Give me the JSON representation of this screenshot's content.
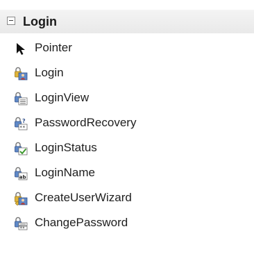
{
  "toolbox": {
    "group": {
      "title": "Login",
      "expanded": true,
      "icon": "collapse-minus-icon"
    },
    "items": [
      {
        "label": "Pointer",
        "icon": "pointer-arrow-icon"
      },
      {
        "label": "Login",
        "icon": "login-control-icon"
      },
      {
        "label": "LoginView",
        "icon": "loginview-control-icon"
      },
      {
        "label": "PasswordRecovery",
        "icon": "password-recovery-icon"
      },
      {
        "label": "LoginStatus",
        "icon": "login-status-icon"
      },
      {
        "label": "LoginName",
        "icon": "login-name-icon"
      },
      {
        "label": "CreateUserWizard",
        "icon": "create-user-wizard-icon"
      },
      {
        "label": "ChangePassword",
        "icon": "change-password-icon"
      }
    ]
  },
  "colors": {
    "header_background": "#ececec",
    "lock_gold": "#e0b43a",
    "lock_blue": "#5f89c7",
    "check_green": "#3f9a2f",
    "text": "#1e1e1e"
  }
}
